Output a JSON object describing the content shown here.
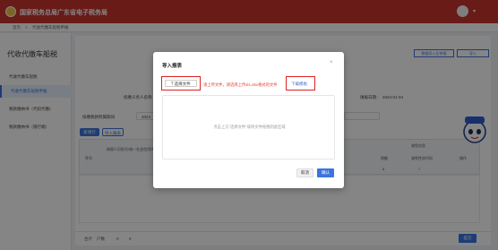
{
  "header": {
    "title": "国家税务总局广东省电子税务局"
  },
  "breadcrumb": {
    "home": "首页",
    "separator": ">",
    "current": "代收代缴车船税申报"
  },
  "sidebar": {
    "title": "代收代缴车船税",
    "group_label": "代收代缴车船税",
    "items": [
      {
        "label": "代收代缴车船税申报"
      },
      {
        "label": "税款缴纳书（代扣代缴）"
      },
      {
        "label": "税款缴纳书（银行端）"
      }
    ]
  },
  "main": {
    "top_buttons": [
      "数据导入后申报",
      "导入"
    ],
    "taxpayer_label": "扣缴义务人名称",
    "date_label": "填报日期：",
    "date_value": "2024-01-04",
    "entity_label": "扣缴税款所属期间",
    "period_prefix": "2024",
    "add_button": "新增行",
    "import_button": "导入报表",
    "grid_headers": {
      "seq": "序号",
      "taxpayer": "纳税人识别号/统一社会信用代码",
      "reduce_group": "减免信息",
      "reduce_sub": [
        "税额",
        "减免性质代码"
      ],
      "reduce_nums": [
        "6",
        "7"
      ],
      "action": "操作"
    },
    "footer": {
      "total_label": "合计",
      "count_label": "户数",
      "count_value": "0",
      "tax_value": "0",
      "submit": "提交"
    }
  },
  "modal": {
    "title": "导入报表",
    "close_icon": "close-icon",
    "choose_file": "选择文件",
    "hint": "请上传文件，请选择上传xls,xlsx格式的文件",
    "download_template": "下载模板",
    "drop_hint": "点击上方“选择文件”或将文件拖拽到此区域",
    "cancel": "取消",
    "confirm": "确认"
  },
  "colors": {
    "brand": "#c9342c",
    "accent": "#3b74e0",
    "highlight": "#e02020"
  }
}
